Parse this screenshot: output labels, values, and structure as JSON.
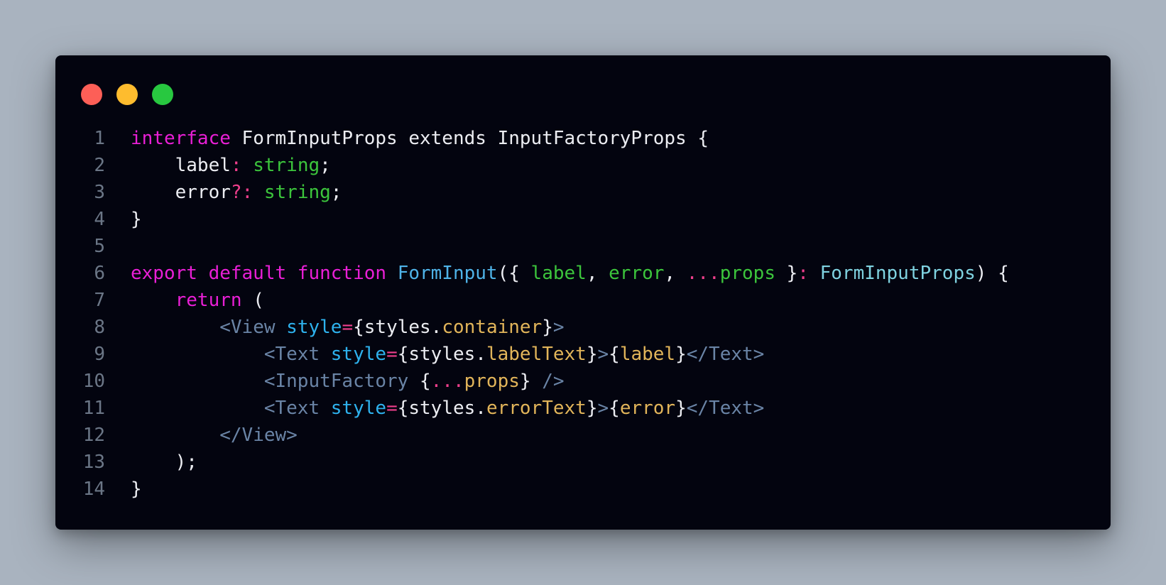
{
  "window": {
    "traffic_lights": [
      {
        "name": "close",
        "color": "#fd5f57"
      },
      {
        "name": "minimize",
        "color": "#febc2e"
      },
      {
        "name": "maximize",
        "color": "#28c840"
      }
    ]
  },
  "colors": {
    "default": "#ecedf2",
    "keyword": "#e91fd6",
    "type": "#3cc53c",
    "param": "#3cc53c",
    "func": "#4fb3e8",
    "type_ref": "#7fd2e0",
    "tag": "#6a84a6",
    "attr": "#2eb2ee",
    "prop": "#e2b55a",
    "op": "#ef3f8c"
  },
  "code": {
    "lines": [
      {
        "number": "1",
        "tokens": [
          {
            "t": "interface",
            "c": "keyword"
          },
          {
            "t": " FormInputProps extends InputFactoryProps {",
            "c": "default"
          }
        ]
      },
      {
        "number": "2",
        "tokens": [
          {
            "t": "    label",
            "c": "default"
          },
          {
            "t": ":",
            "c": "op"
          },
          {
            "t": " string",
            "c": "type"
          },
          {
            "t": ";",
            "c": "default"
          }
        ]
      },
      {
        "number": "3",
        "tokens": [
          {
            "t": "    error",
            "c": "default"
          },
          {
            "t": "?:",
            "c": "op"
          },
          {
            "t": " string",
            "c": "type"
          },
          {
            "t": ";",
            "c": "default"
          }
        ]
      },
      {
        "number": "4",
        "tokens": [
          {
            "t": "}",
            "c": "default"
          }
        ]
      },
      {
        "number": "5",
        "tokens": []
      },
      {
        "number": "6",
        "tokens": [
          {
            "t": "export default function",
            "c": "keyword"
          },
          {
            "t": " ",
            "c": "default"
          },
          {
            "t": "FormInput",
            "c": "func"
          },
          {
            "t": "({ ",
            "c": "default"
          },
          {
            "t": "label",
            "c": "param"
          },
          {
            "t": ", ",
            "c": "default"
          },
          {
            "t": "error",
            "c": "param"
          },
          {
            "t": ", ",
            "c": "default"
          },
          {
            "t": "...",
            "c": "op"
          },
          {
            "t": "props",
            "c": "param"
          },
          {
            "t": " }",
            "c": "default"
          },
          {
            "t": ":",
            "c": "op"
          },
          {
            "t": " ",
            "c": "default"
          },
          {
            "t": "FormInputProps",
            "c": "type_ref"
          },
          {
            "t": ") {",
            "c": "default"
          }
        ]
      },
      {
        "number": "7",
        "tokens": [
          {
            "t": "    ",
            "c": "default"
          },
          {
            "t": "return",
            "c": "keyword"
          },
          {
            "t": " (",
            "c": "default"
          }
        ]
      },
      {
        "number": "8",
        "tokens": [
          {
            "t": "        ",
            "c": "default"
          },
          {
            "t": "<View",
            "c": "tag"
          },
          {
            "t": " ",
            "c": "default"
          },
          {
            "t": "style",
            "c": "attr"
          },
          {
            "t": "=",
            "c": "op"
          },
          {
            "t": "{styles.",
            "c": "default"
          },
          {
            "t": "container",
            "c": "prop"
          },
          {
            "t": "}",
            "c": "default"
          },
          {
            "t": ">",
            "c": "tag"
          }
        ]
      },
      {
        "number": "9",
        "tokens": [
          {
            "t": "            ",
            "c": "default"
          },
          {
            "t": "<Text",
            "c": "tag"
          },
          {
            "t": " ",
            "c": "default"
          },
          {
            "t": "style",
            "c": "attr"
          },
          {
            "t": "=",
            "c": "op"
          },
          {
            "t": "{styles.",
            "c": "default"
          },
          {
            "t": "labelText",
            "c": "prop"
          },
          {
            "t": "}",
            "c": "default"
          },
          {
            "t": ">",
            "c": "tag"
          },
          {
            "t": "{",
            "c": "default"
          },
          {
            "t": "label",
            "c": "prop"
          },
          {
            "t": "}",
            "c": "default"
          },
          {
            "t": "</Text>",
            "c": "tag"
          }
        ]
      },
      {
        "number": "10",
        "tokens": [
          {
            "t": "            ",
            "c": "default"
          },
          {
            "t": "<InputFactory",
            "c": "tag"
          },
          {
            "t": " {",
            "c": "default"
          },
          {
            "t": "...",
            "c": "op"
          },
          {
            "t": "props",
            "c": "prop"
          },
          {
            "t": "}",
            "c": "default"
          },
          {
            "t": " />",
            "c": "tag"
          }
        ]
      },
      {
        "number": "11",
        "tokens": [
          {
            "t": "            ",
            "c": "default"
          },
          {
            "t": "<Text",
            "c": "tag"
          },
          {
            "t": " ",
            "c": "default"
          },
          {
            "t": "style",
            "c": "attr"
          },
          {
            "t": "=",
            "c": "op"
          },
          {
            "t": "{styles.",
            "c": "default"
          },
          {
            "t": "errorText",
            "c": "prop"
          },
          {
            "t": "}",
            "c": "default"
          },
          {
            "t": ">",
            "c": "tag"
          },
          {
            "t": "{",
            "c": "default"
          },
          {
            "t": "error",
            "c": "prop"
          },
          {
            "t": "}",
            "c": "default"
          },
          {
            "t": "</Text>",
            "c": "tag"
          }
        ]
      },
      {
        "number": "12",
        "tokens": [
          {
            "t": "        ",
            "c": "default"
          },
          {
            "t": "</View>",
            "c": "tag"
          }
        ]
      },
      {
        "number": "13",
        "tokens": [
          {
            "t": "    );",
            "c": "default"
          }
        ]
      },
      {
        "number": "14",
        "tokens": [
          {
            "t": "}",
            "c": "default"
          }
        ]
      }
    ]
  }
}
